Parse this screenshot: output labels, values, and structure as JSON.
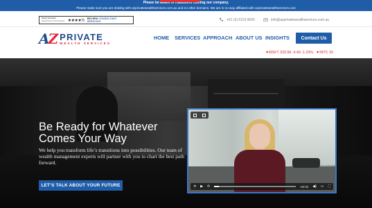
{
  "alert": {
    "line1": "Please be aware of fraudsters cloning our company.",
    "line2": "Please make sure you are dealing with azprivatewealthservices.com.au and no other domains. We are in no way affiliated with azprivatewealthservices.com"
  },
  "utility": {
    "review_badge": {
      "left_label": "Rated Excellent",
      "left_sub": "Read Reviews of Our Business",
      "stars": "★★★★½",
      "brand_prefix": "REVIEW",
      "brand_suffix": "CONSULTANT SERVICES"
    },
    "phone": "+61 (3) 5119 9600",
    "email": "info@azprivatewealthservices.com.au"
  },
  "header": {
    "logo": {
      "mark_a": "A",
      "mark_z": "Z",
      "name": "PRIVATE",
      "tagline": "WEALTH SERVICES"
    },
    "nav": [
      {
        "label": "HOME"
      },
      {
        "label": "SERVICES"
      },
      {
        "label": "APPROACH"
      },
      {
        "label": "ABOUT US"
      },
      {
        "label": "INSIGHTS"
      }
    ],
    "cta": "Contact Us",
    "tickers": [
      {
        "text": "▼MSFT 333.58 -4.49 -1.33%"
      },
      {
        "text": "▼INTC 32"
      }
    ]
  },
  "hero": {
    "title": "Be Ready for Whatever Comes Your Way",
    "subtitle": "We help you transform life’s transitions into possibilities. Our team of wealth management experts will partner with you to chart the best path forward.",
    "button": "LET’S TALK ABOUT YOUR FUTURE"
  },
  "video": {
    "progress_fraction": 0.06,
    "time_left": "-00:00"
  },
  "colors": {
    "brand_blue": "#1f5da8",
    "brand_red": "#e0263a",
    "ticker_red": "#d92a2a"
  }
}
